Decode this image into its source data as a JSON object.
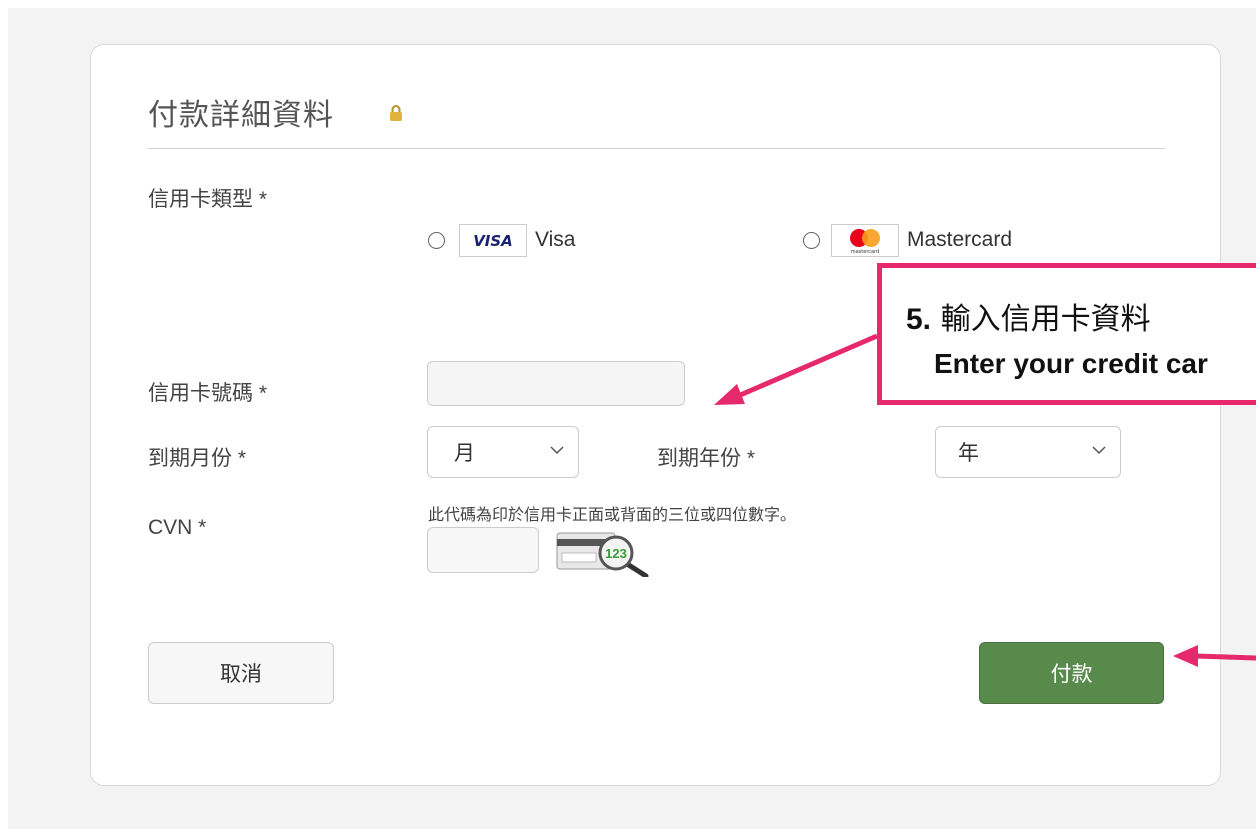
{
  "form": {
    "title": "付款詳細資料",
    "card_type_label": "信用卡類型 *",
    "options": [
      {
        "badge": "VISA",
        "label": "Visa",
        "icon": "visa-logo"
      },
      {
        "badge": "mastercard",
        "label": "Mastercard",
        "icon": "mastercard-logo"
      }
    ],
    "card_number_label": "信用卡號碼 *",
    "card_number_value": "",
    "expiry_month_label": "到期月份 *",
    "expiry_month_value": "月",
    "expiry_year_label": "到期年份 *",
    "expiry_year_value": "年",
    "cvn_label": "CVN *",
    "cvn_hint": "此代碼為印於信用卡正面或背面的三位或四位數字。",
    "cvn_value": "",
    "cvn_example_digits": "123",
    "cancel_label": "取消",
    "pay_label": "付款"
  },
  "callout": {
    "step_number": "5.",
    "line1": "輸入信用卡資料",
    "line2": "Enter your credit car"
  },
  "colors": {
    "accent_pink": "#e6296a",
    "pay_green": "#578a4b",
    "lock_gold": "#e3b23c"
  }
}
